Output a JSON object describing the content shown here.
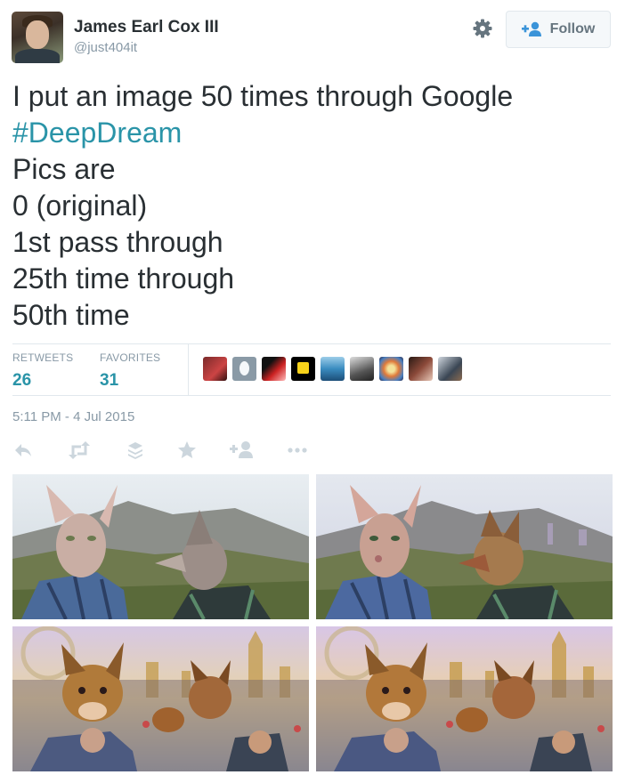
{
  "author": {
    "display_name": "James Earl Cox III",
    "screen_name": "@just404it"
  },
  "follow_button": {
    "label": "Follow"
  },
  "tweet": {
    "lines": [
      "I put an image 50 times through Google",
      "#DeepDream",
      "Pics are",
      "0 (original)",
      "1st pass through",
      "25th time through",
      "50th time"
    ]
  },
  "stats": {
    "retweets_label": "RETWEETS",
    "retweets_count": "26",
    "favorites_label": "FAVORITES",
    "favorites_count": "31"
  },
  "timestamp": "5:11 PM - 4 Jul 2015",
  "actions": [
    "reply-icon",
    "retweet-icon",
    "buffer-icon",
    "favorite-icon",
    "follow-icon",
    "more-icon"
  ],
  "colors": {
    "accent": "#2a94a8",
    "muted": "#8899a6",
    "text": "#292f33"
  }
}
